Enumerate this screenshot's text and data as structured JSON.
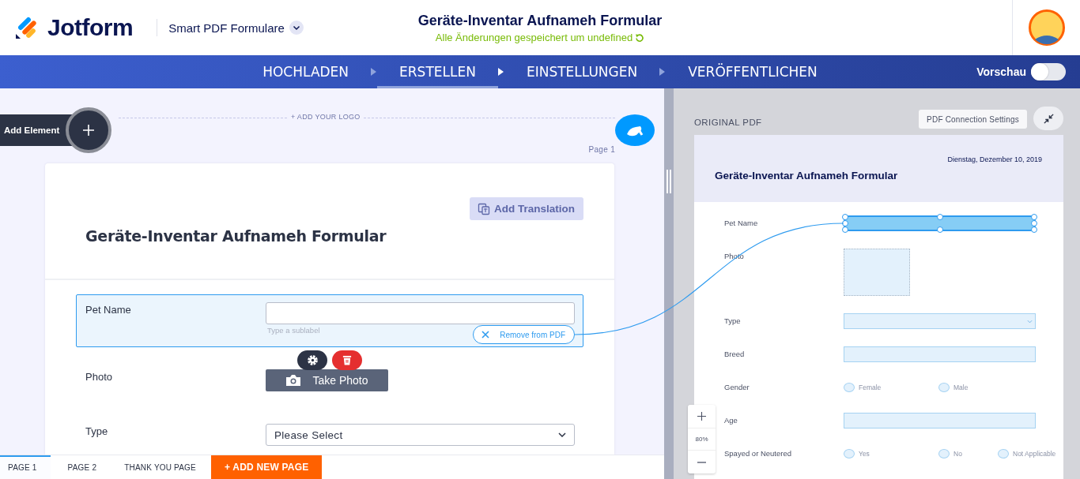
{
  "header": {
    "logo": "Jotform",
    "product": "Smart PDF Formulare",
    "title": "Geräte-Inventar Aufnameh Formular",
    "save_status": "Alle Änderungen gespeichert um undefined"
  },
  "nav": {
    "steps": [
      {
        "label": "HOCHLADEN",
        "selected": false
      },
      {
        "label": "ERSTELLEN",
        "selected": true
      },
      {
        "label": "EINSTELLUNGEN",
        "selected": false
      },
      {
        "label": "VERÖFFENTLICHEN",
        "selected": false
      }
    ],
    "preview": {
      "label": "Vorschau",
      "on": false
    }
  },
  "builder": {
    "add_element": "Add Element",
    "add_logo": "+ ADD YOUR LOGO",
    "page_label": "Page 1",
    "form": {
      "title": "Geräte-Inventar Aufnameh Formular",
      "add_translation": "Add Translation",
      "fields": [
        {
          "kind": "textbox",
          "label": "Pet Name",
          "selected": true,
          "sublabel_placeholder": "Type a sublabel",
          "remove_button": "Remove from PDF"
        },
        {
          "kind": "photo",
          "label": "Photo",
          "selected": false,
          "button": "Take Photo"
        },
        {
          "kind": "dropdown",
          "label": "Type",
          "selected": false,
          "placeholder": "Please Select"
        }
      ]
    },
    "page_tabs": [
      {
        "label": "PAGE 1",
        "selected": true
      },
      {
        "label": "PAGE 2",
        "selected": false
      },
      {
        "label": "THANK YOU PAGE",
        "selected": false
      }
    ],
    "add_page": "+ ADD NEW PAGE"
  },
  "pdf": {
    "label": "ORIGINAL PDF",
    "settings_button": "PDF Connection Settings",
    "zoom": "80%",
    "page": {
      "date": "Dienstag, Dezember 10, 2019",
      "title": "Geräte-Inventar Aufnameh Formular",
      "fields": [
        {
          "kind": "text",
          "label": "Pet Name",
          "selected": true
        },
        {
          "kind": "photo",
          "label": "Photo",
          "selected": false
        },
        {
          "kind": "dropdown",
          "label": "Type",
          "selected": false
        },
        {
          "kind": "text",
          "label": "Breed",
          "selected": false
        },
        {
          "kind": "radio",
          "label": "Gender",
          "selected": false,
          "options": [
            "Female",
            "Male"
          ]
        },
        {
          "kind": "text",
          "label": "Age",
          "selected": false
        },
        {
          "kind": "radio",
          "label": "Spayed or Neutered",
          "selected": false,
          "options": [
            "Yes",
            "No",
            "Not Applicable"
          ]
        }
      ]
    }
  }
}
